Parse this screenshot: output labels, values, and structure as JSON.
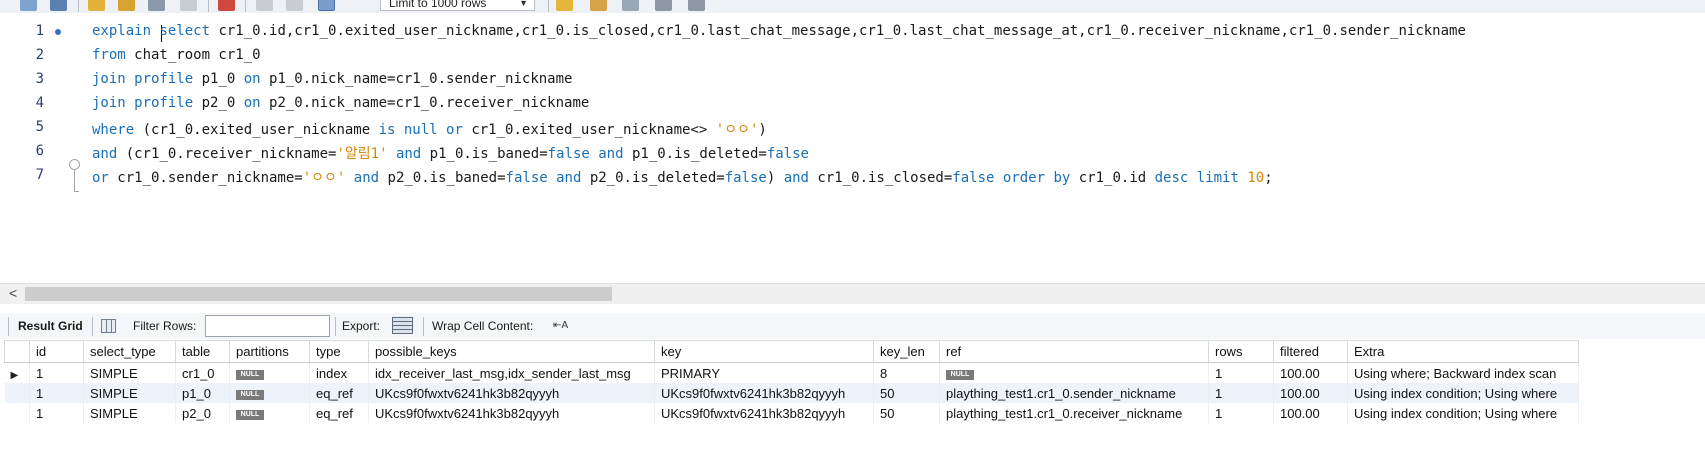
{
  "toolbar": {
    "limit_value": "Limit to 1000 rows"
  },
  "editor": {
    "line_numbers": [
      "1",
      "2",
      "3",
      "4",
      "5",
      "6",
      "7"
    ],
    "lines": [
      [
        {
          "t": "kw",
          "v": "explain "
        },
        {
          "t": "kw",
          "v": "select"
        },
        {
          "t": "p",
          "v": " cr1_0.id,cr1_0.exited_user_nickname,cr1_0.is_closed,cr1_0.last_chat_message,cr1_0.last_chat_message_at,cr1_0.receiver_nickname,cr1_0.sender_nickname"
        }
      ],
      [
        {
          "t": "kw",
          "v": "from"
        },
        {
          "t": "p",
          "v": " chat_room cr1_0"
        }
      ],
      [
        {
          "t": "kw",
          "v": "join profile"
        },
        {
          "t": "p",
          "v": " p1_0 "
        },
        {
          "t": "kw",
          "v": "on"
        },
        {
          "t": "p",
          "v": " p1_0.nick_name=cr1_0.sender_nickname"
        }
      ],
      [
        {
          "t": "kw",
          "v": "join profile"
        },
        {
          "t": "p",
          "v": " p2_0 "
        },
        {
          "t": "kw",
          "v": "on"
        },
        {
          "t": "p",
          "v": " p2_0.nick_name=cr1_0.receiver_nickname"
        }
      ],
      [
        {
          "t": "kw",
          "v": "where"
        },
        {
          "t": "p",
          "v": " (cr1_0.exited_user_nickname "
        },
        {
          "t": "kw",
          "v": "is null or"
        },
        {
          "t": "p",
          "v": " cr1_0.exited_user_nickname<> "
        },
        {
          "t": "str",
          "v": "'ㅇㅇ'"
        },
        {
          "t": "p",
          "v": ")"
        }
      ],
      [
        {
          "t": "kw",
          "v": "and"
        },
        {
          "t": "p",
          "v": " (cr1_0.receiver_nickname="
        },
        {
          "t": "str",
          "v": "'알림1'"
        },
        {
          "t": "p",
          "v": " "
        },
        {
          "t": "kw",
          "v": "and"
        },
        {
          "t": "p",
          "v": " p1_0.is_baned="
        },
        {
          "t": "kw",
          "v": "false and"
        },
        {
          "t": "p",
          "v": " p1_0.is_deleted="
        },
        {
          "t": "kw",
          "v": "false"
        }
      ],
      [
        {
          "t": "kw",
          "v": "or"
        },
        {
          "t": "p",
          "v": " cr1_0.sender_nickname="
        },
        {
          "t": "str",
          "v": "'ㅇㅇ'"
        },
        {
          "t": "p",
          "v": " "
        },
        {
          "t": "kw",
          "v": "and"
        },
        {
          "t": "p",
          "v": " p2_0.is_baned="
        },
        {
          "t": "kw",
          "v": "false and"
        },
        {
          "t": "p",
          "v": " p2_0.is_deleted="
        },
        {
          "t": "kw",
          "v": "false"
        },
        {
          "t": "p",
          "v": ") "
        },
        {
          "t": "kw",
          "v": "and"
        },
        {
          "t": "p",
          "v": " cr1_0.is_closed="
        },
        {
          "t": "kw",
          "v": "false order by"
        },
        {
          "t": "p",
          "v": " cr1_0.id "
        },
        {
          "t": "kw",
          "v": "desc limit"
        },
        {
          "t": "p",
          "v": " "
        },
        {
          "t": "num",
          "v": "10"
        },
        {
          "t": "p",
          "v": ";"
        }
      ]
    ]
  },
  "result_toolbar": {
    "result_grid_label": "Result Grid",
    "filter_rows_label": "Filter Rows:",
    "filter_value": "",
    "export_label": "Export:",
    "wrap_label": "Wrap Cell Content:"
  },
  "grid": {
    "columns": [
      "id",
      "select_type",
      "table",
      "partitions",
      "type",
      "possible_keys",
      "key",
      "key_len",
      "ref",
      "rows",
      "filtered",
      "Extra"
    ],
    "null_label": "NULL",
    "rows": [
      [
        "1",
        "SIMPLE",
        "cr1_0",
        null,
        "index",
        "idx_receiver_last_msg,idx_sender_last_msg",
        "PRIMARY",
        "8",
        null,
        "1",
        "100.00",
        "Using where; Backward index scan"
      ],
      [
        "1",
        "SIMPLE",
        "p1_0",
        null,
        "eq_ref",
        "UKcs9f0fwxtv6241hk3b82qyyyh",
        "UKcs9f0fwxtv6241hk3b82qyyyh",
        "50",
        "plaything_test1.cr1_0.sender_nickname",
        "1",
        "100.00",
        "Using index condition; Using where"
      ],
      [
        "1",
        "SIMPLE",
        "p2_0",
        null,
        "eq_ref",
        "UKcs9f0fwxtv6241hk3b82qyyyh",
        "UKcs9f0fwxtv6241hk3b82qyyyh",
        "50",
        "plaything_test1.cr1_0.receiver_nickname",
        "1",
        "100.00",
        "Using index condition; Using where"
      ]
    ]
  },
  "colors": {
    "keyword": "#1a6fb5",
    "string": "#d4870b",
    "row_alt": "#eef2fa"
  }
}
